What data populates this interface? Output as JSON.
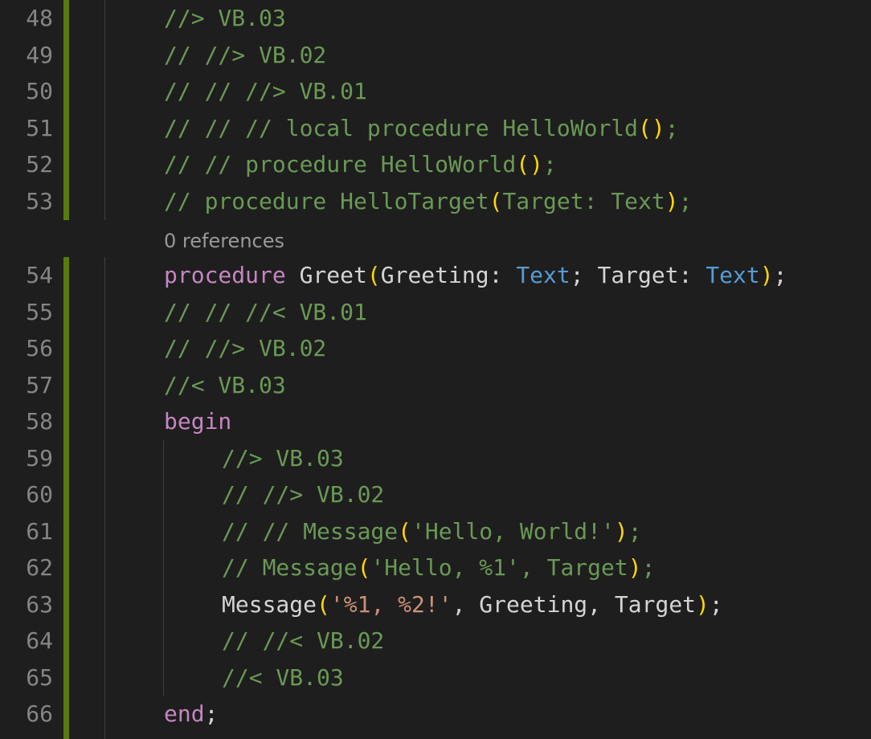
{
  "editor": {
    "codelens": "0 references",
    "colors": {
      "background": "#1e1e1e",
      "comment": "#6a9955",
      "keyword": "#c586c0",
      "type": "#569cd6",
      "string": "#ce9178",
      "bracket": "#ffd700",
      "text": "#d4d4d4",
      "gutter_modified": "#587c0c"
    },
    "lines": [
      {
        "number": "48",
        "tokens": [
          {
            "c": "c",
            "v": "//> VB.03"
          }
        ]
      },
      {
        "number": "49",
        "tokens": [
          {
            "c": "c",
            "v": "// //> VB.02"
          }
        ]
      },
      {
        "number": "50",
        "tokens": [
          {
            "c": "c",
            "v": "// // //> VB.01"
          }
        ]
      },
      {
        "number": "51",
        "tokens": [
          {
            "c": "c",
            "v": "// // // local procedure HelloWorld"
          },
          {
            "c": "p",
            "v": "()"
          },
          {
            "c": "c",
            "v": ";"
          }
        ]
      },
      {
        "number": "52",
        "tokens": [
          {
            "c": "c",
            "v": "// // procedure HelloWorld"
          },
          {
            "c": "p",
            "v": "()"
          },
          {
            "c": "c",
            "v": ";"
          }
        ]
      },
      {
        "number": "53",
        "tokens": [
          {
            "c": "c",
            "v": "// procedure HelloTarget"
          },
          {
            "c": "p",
            "v": "("
          },
          {
            "c": "c",
            "v": "Target: Text"
          },
          {
            "c": "p",
            "v": ")"
          },
          {
            "c": "c",
            "v": ";"
          }
        ]
      },
      {
        "number": "54",
        "tokens": [
          {
            "c": "k",
            "v": "procedure"
          },
          {
            "c": "d",
            "v": " Greet"
          },
          {
            "c": "p",
            "v": "("
          },
          {
            "c": "d",
            "v": "Greeting: "
          },
          {
            "c": "t",
            "v": "Text"
          },
          {
            "c": "d",
            "v": "; Target: "
          },
          {
            "c": "t",
            "v": "Text"
          },
          {
            "c": "p",
            "v": ")"
          },
          {
            "c": "d",
            "v": ";"
          }
        ]
      },
      {
        "number": "55",
        "tokens": [
          {
            "c": "c",
            "v": "// // //< VB.01"
          }
        ]
      },
      {
        "number": "56",
        "tokens": [
          {
            "c": "c",
            "v": "// //> VB.02"
          }
        ]
      },
      {
        "number": "57",
        "tokens": [
          {
            "c": "c",
            "v": "//< VB.03"
          }
        ]
      },
      {
        "number": "58",
        "tokens": [
          {
            "c": "k",
            "v": "begin"
          }
        ]
      },
      {
        "number": "59",
        "indent": 1,
        "tokens": [
          {
            "c": "c",
            "v": "//> VB.03"
          }
        ]
      },
      {
        "number": "60",
        "indent": 1,
        "tokens": [
          {
            "c": "c",
            "v": "// //> VB.02"
          }
        ]
      },
      {
        "number": "61",
        "indent": 1,
        "tokens": [
          {
            "c": "c",
            "v": "// // Message"
          },
          {
            "c": "p",
            "v": "("
          },
          {
            "c": "c",
            "v": "'Hello, World!'"
          },
          {
            "c": "p",
            "v": ")"
          },
          {
            "c": "c",
            "v": ";"
          }
        ]
      },
      {
        "number": "62",
        "indent": 1,
        "tokens": [
          {
            "c": "c",
            "v": "// Message"
          },
          {
            "c": "p",
            "v": "("
          },
          {
            "c": "c",
            "v": "'Hello, %1', Target"
          },
          {
            "c": "p",
            "v": ")"
          },
          {
            "c": "c",
            "v": ";"
          }
        ]
      },
      {
        "number": "63",
        "indent": 1,
        "tokens": [
          {
            "c": "d",
            "v": "Message"
          },
          {
            "c": "p",
            "v": "("
          },
          {
            "c": "s",
            "v": "'%1, %2!'"
          },
          {
            "c": "d",
            "v": ", Greeting, Target"
          },
          {
            "c": "p",
            "v": ")"
          },
          {
            "c": "d",
            "v": ";"
          }
        ]
      },
      {
        "number": "64",
        "indent": 1,
        "tokens": [
          {
            "c": "c",
            "v": "// //< VB.02"
          }
        ]
      },
      {
        "number": "65",
        "indent": 1,
        "tokens": [
          {
            "c": "c",
            "v": "//< VB.03"
          }
        ]
      },
      {
        "number": "66",
        "tokens": [
          {
            "c": "k",
            "v": "end"
          },
          {
            "c": "d",
            "v": ";"
          }
        ]
      }
    ]
  }
}
